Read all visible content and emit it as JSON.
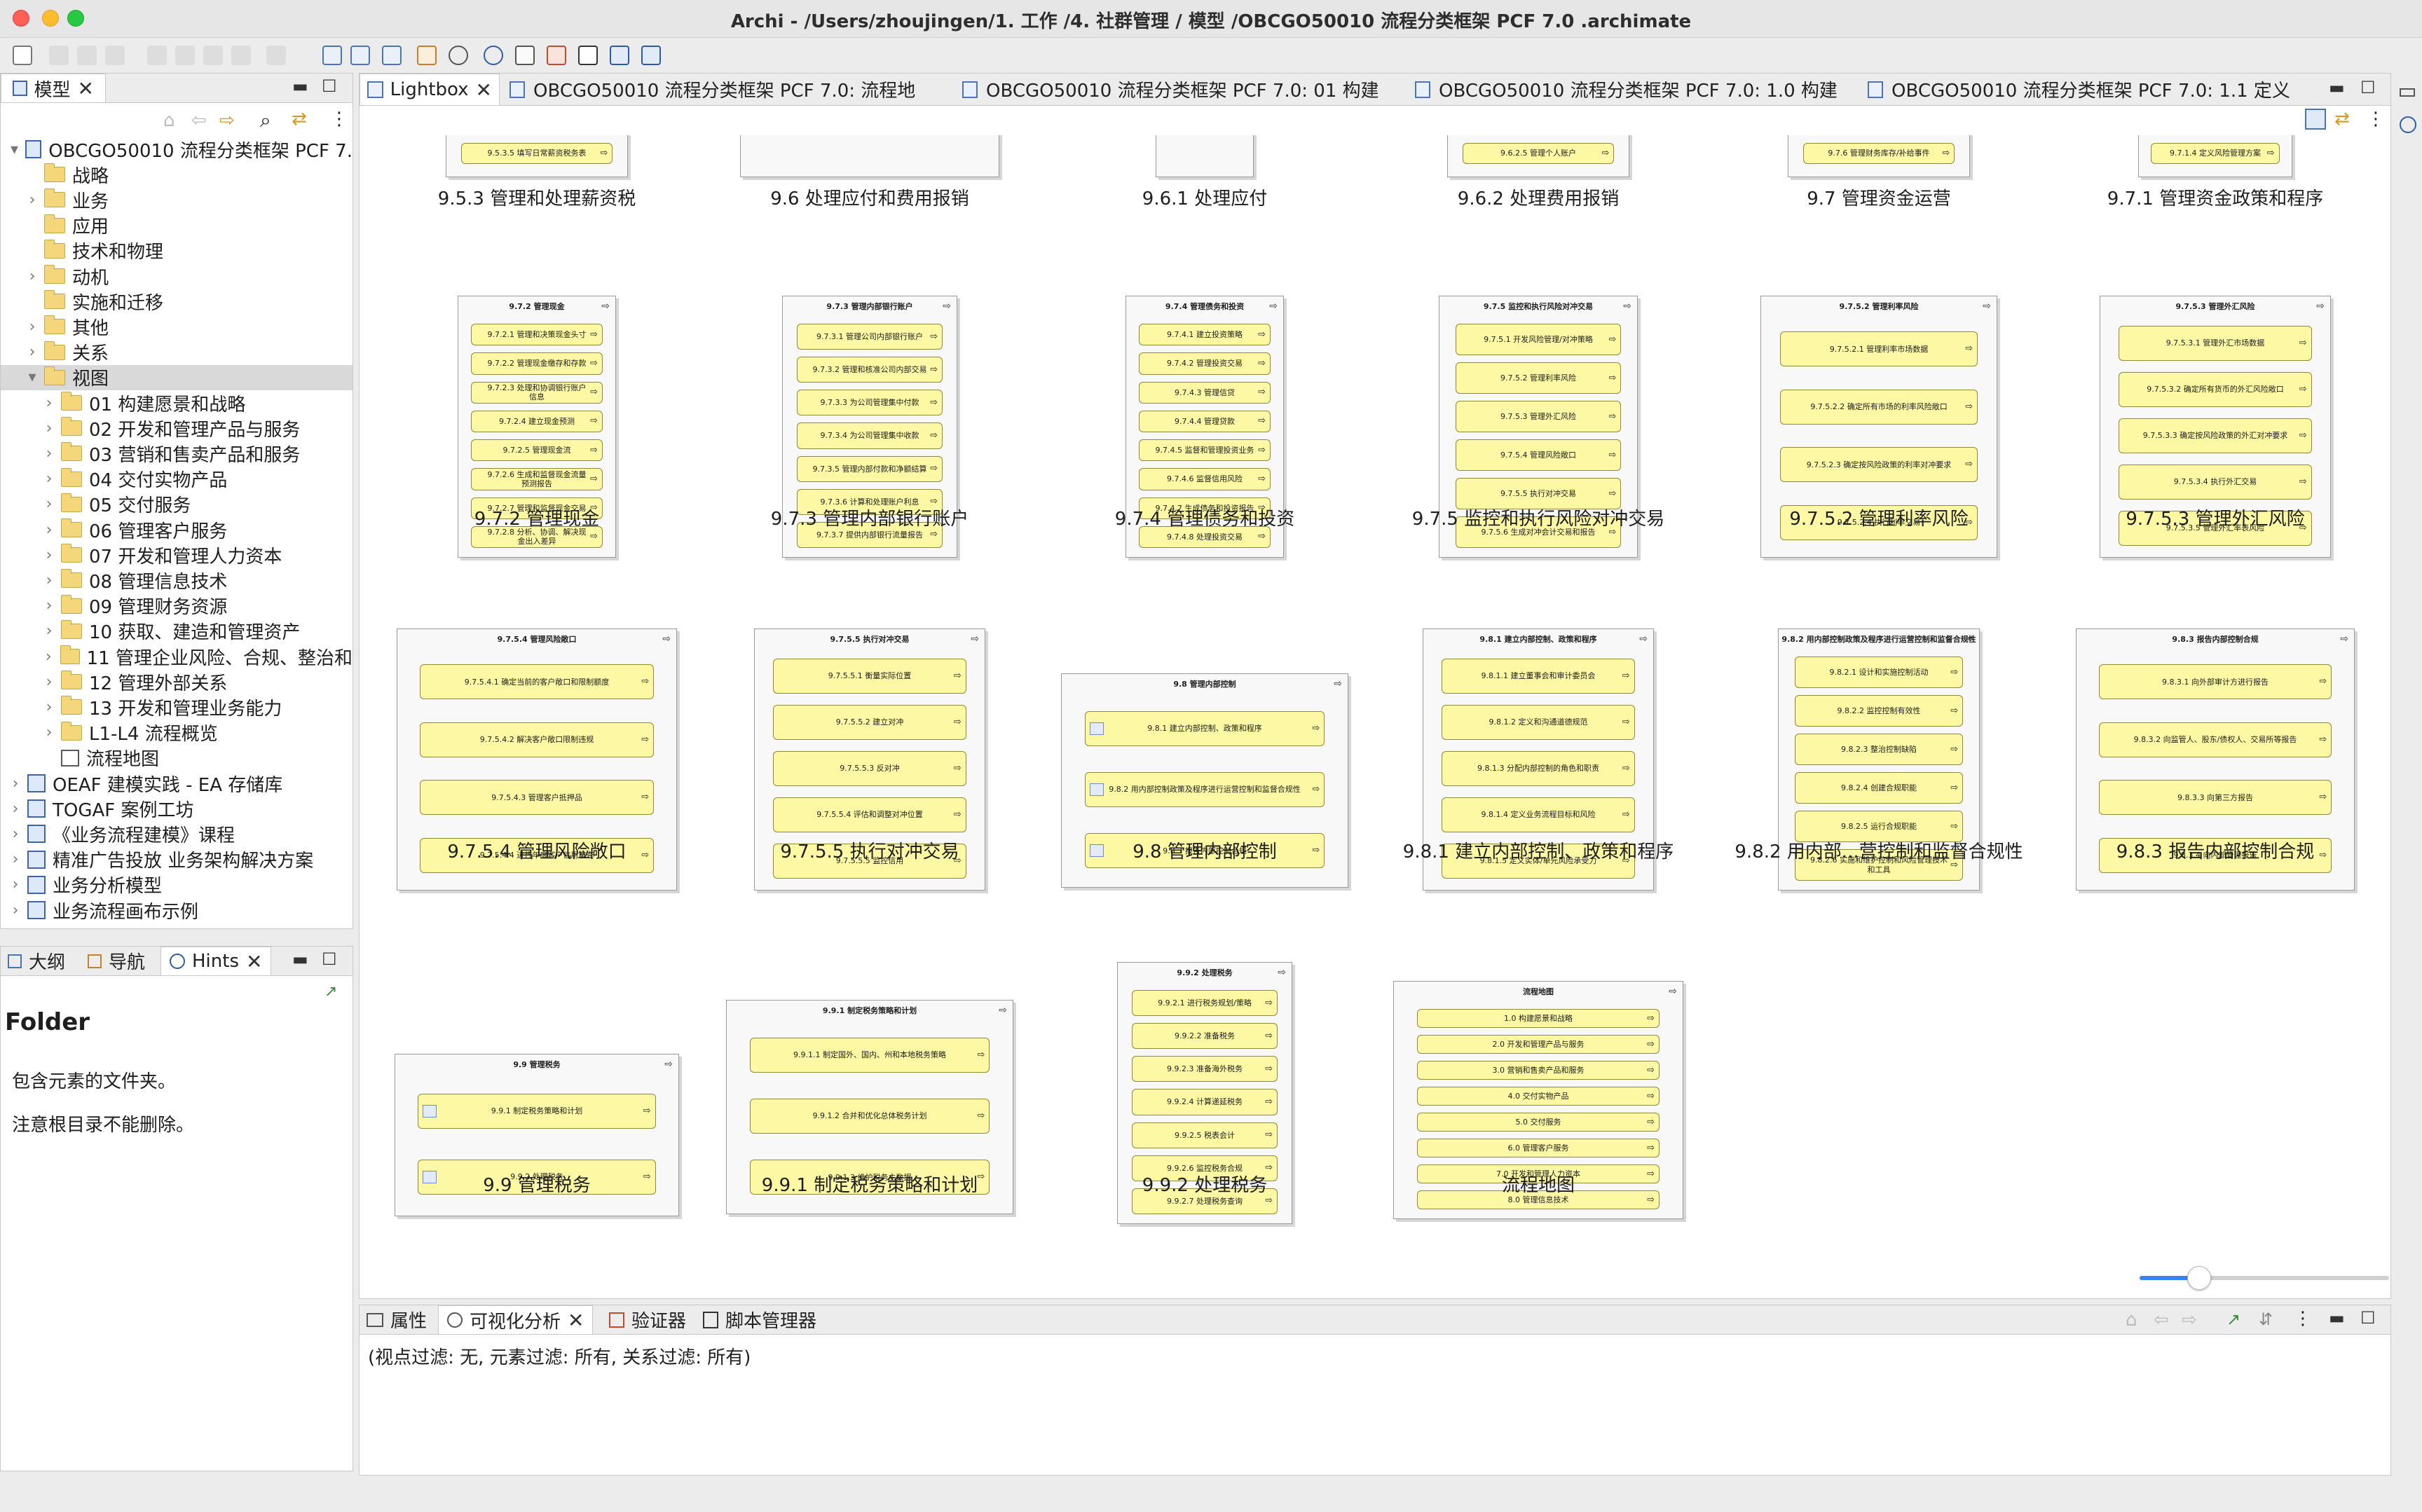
{
  "window": {
    "title": "Archi - /Users/zhoujingen/1. 工作 /4. 社群管理 / 模型 /OBCGO50010 流程分类框架 PCF 7.0 .archimate"
  },
  "left_panel": {
    "tab_label": "模型",
    "tree": [
      {
        "label": "OBCGO50010 流程分类框架 PCF 7.",
        "kind": "model",
        "twisty": "▾",
        "depth": 0
      },
      {
        "label": "战略",
        "kind": "folder",
        "twisty": "",
        "depth": 1
      },
      {
        "label": "业务",
        "kind": "folder",
        "twisty": "›",
        "depth": 1
      },
      {
        "label": "应用",
        "kind": "folder",
        "twisty": "",
        "depth": 1
      },
      {
        "label": "技术和物理",
        "kind": "folder",
        "twisty": "",
        "depth": 1
      },
      {
        "label": "动机",
        "kind": "folder",
        "twisty": "›",
        "depth": 1
      },
      {
        "label": "实施和迁移",
        "kind": "folder",
        "twisty": "",
        "depth": 1
      },
      {
        "label": "其他",
        "kind": "folder",
        "twisty": "›",
        "depth": 1
      },
      {
        "label": "关系",
        "kind": "folder",
        "twisty": "›",
        "depth": 1
      },
      {
        "label": "视图",
        "kind": "folder",
        "twisty": "▾",
        "depth": 1,
        "selected": true
      },
      {
        "label": "01 构建愿景和战略",
        "kind": "folder",
        "twisty": "›",
        "depth": 2
      },
      {
        "label": "02 开发和管理产品与服务",
        "kind": "folder",
        "twisty": "›",
        "depth": 2
      },
      {
        "label": "03 营销和售卖产品和服务",
        "kind": "folder",
        "twisty": "›",
        "depth": 2
      },
      {
        "label": "04 交付实物产品",
        "kind": "folder",
        "twisty": "›",
        "depth": 2
      },
      {
        "label": "05 交付服务",
        "kind": "folder",
        "twisty": "›",
        "depth": 2
      },
      {
        "label": "06 管理客户服务",
        "kind": "folder",
        "twisty": "›",
        "depth": 2
      },
      {
        "label": "07 开发和管理人力资本",
        "kind": "folder",
        "twisty": "›",
        "depth": 2
      },
      {
        "label": "08 管理信息技术",
        "kind": "folder",
        "twisty": "›",
        "depth": 2
      },
      {
        "label": "09 管理财务资源",
        "kind": "folder",
        "twisty": "›",
        "depth": 2
      },
      {
        "label": "10 获取、建造和管理资产",
        "kind": "folder",
        "twisty": "›",
        "depth": 2
      },
      {
        "label": "11 管理企业风险、合规、整治和",
        "kind": "folder",
        "twisty": "›",
        "depth": 2
      },
      {
        "label": "12 管理外部关系",
        "kind": "folder",
        "twisty": "›",
        "depth": 2
      },
      {
        "label": "13 开发和管理业务能力",
        "kind": "folder",
        "twisty": "›",
        "depth": 2
      },
      {
        "label": "L1-L4 流程概览",
        "kind": "folder",
        "twisty": "›",
        "depth": 2
      },
      {
        "label": "流程地图",
        "kind": "map",
        "twisty": "",
        "depth": 2
      },
      {
        "label": "OEAF 建模实践 - EA 存储库",
        "kind": "model",
        "twisty": "›",
        "depth": 0
      },
      {
        "label": "TOGAF 案例工坊",
        "kind": "model",
        "twisty": "›",
        "depth": 0
      },
      {
        "label": "《业务流程建模》课程",
        "kind": "model",
        "twisty": "›",
        "depth": 0
      },
      {
        "label": "精准广告投放 业务架构解决方案",
        "kind": "model",
        "twisty": "›",
        "depth": 0
      },
      {
        "label": "业务分析模型",
        "kind": "model",
        "twisty": "›",
        "depth": 0
      },
      {
        "label": "业务流程画布示例",
        "kind": "model",
        "twisty": "›",
        "depth": 0
      }
    ]
  },
  "hints_panel": {
    "tabs": [
      "大纲",
      "导航",
      "Hints"
    ],
    "heading": "Folder",
    "line1": "包含元素的文件夹。",
    "line2": "注意根目录不能删除。"
  },
  "editor": {
    "tabs": [
      "Lightbox",
      "OBCGO50010 流程分类框架 PCF 7.0: 流程地",
      "OBCGO50010 流程分类框架 PCF 7.0: 01 构建",
      "OBCGO50010 流程分类框架 PCF 7.0: 1.0 构建",
      "OBCGO50010 流程分类框架 PCF 7.0: 1.1 定义"
    ],
    "zoom_fraction": 0.24
  },
  "lightbox": {
    "row0": [
      "9.5.3 管理和处理薪资税",
      "9.6 处理应付和费用报销",
      "9.6.1 处理应付",
      "9.6.2 处理费用报销",
      "9.7 管理资金运营",
      "9.7.1 管理资金政策和程序"
    ],
    "row0_boxes": [
      "9.5.3.5 填写日常薪资税务表",
      "",
      "",
      "9.6.2.5 管理个人账户",
      "9.7.6 管理财务库存/补给事件",
      "9.7.1.4 定义风险管理方案"
    ],
    "cards": [
      {
        "label": "9.7.2 管理现金",
        "title": "9.7.2 管理现金",
        "boxes": [
          "9.7.2.1 管理和决策现金头寸",
          "9.7.2.2 管理现金缴存和存款",
          "9.7.2.3 处理和协调银行账户信息",
          "9.7.2.4 建立现金预测",
          "9.7.2.5 管理现金流",
          "9.7.2.6 生成和监督现金流量预测报告",
          "9.7.2.7 管理和监督现金交易",
          "9.7.2.8 分析、协调、解决现金出入差异"
        ]
      },
      {
        "label": "9.7.3 管理内部银行账户",
        "title": "9.7.3 管理内部银行账户",
        "boxes": [
          "9.7.3.1 管理公司内部银行账户",
          "9.7.3.2 管理和核准公司内部交易",
          "9.7.3.3 为公司管理集中付款",
          "9.7.3.4 为公司管理集中收款",
          "9.7.3.5 管理内部付款和净额结算",
          "9.7.3.6 计算和处理账户利息",
          "9.7.3.7 提供内部银行流量报告"
        ]
      },
      {
        "label": "9.7.4 管理债务和投资",
        "title": "9.7.4 管理债务和投资",
        "boxes": [
          "9.7.4.1 建立投资策略",
          "9.7.4.2 管理投资交易",
          "9.7.4.3 管理信贷",
          "9.7.4.4 管理贷款",
          "9.7.4.5 监督和管理投资业务",
          "9.7.4.6 监督信用风险",
          "9.7.4.7 生成债务和投资报告",
          "9.7.4.8 处理投资交易"
        ]
      },
      {
        "label": "9.7.5 监控和执行风险对冲交易",
        "title": "9.7.5 监控和执行风险对冲交易",
        "boxes": [
          "9.7.5.1 开发风险管理/对冲策略",
          "9.7.5.2 管理利率风险",
          "9.7.5.3 管理外汇风险",
          "9.7.5.4 管理风险敞口",
          "9.7.5.5 执行对冲交易",
          "9.7.5.6 生成对冲会计交易和报告"
        ]
      },
      {
        "label": "9.7.5.2 管理利率风险",
        "title": "9.7.5.2 管理利率风险",
        "boxes": [
          "9.7.5.2.1 管理利率市场数据",
          "9.7.5.2.2 确定所有市场的利率风险敞口",
          "9.7.5.2.3 确定按风险政策的利率对冲要求",
          "9.7.5.2.4 执行利率交易"
        ]
      },
      {
        "label": "9.7.5.3 管理外汇风险",
        "title": "9.7.5.3 管理外汇风险",
        "boxes": [
          "9.7.5.3.1 管理外汇市场数据",
          "9.7.5.3.2 确定所有货币的外汇风险敞口",
          "9.7.5.3.3 确定按风险政策的外汇对冲要求",
          "9.7.5.3.4 执行外汇交易",
          "9.7.5.3.5 管理外汇率表风险"
        ]
      },
      {
        "label": "9.7.5.4 管理风险敞口",
        "title": "9.7.5.4 管理风险敞口",
        "boxes": [
          "9.7.5.4.1 确定当前的客户敞口和限制额度",
          "9.7.5.4.2 解决客户敞口限制违规",
          "9.7.5.4.3 管理客户抵押品",
          "9.7.5.4.4 进行年度客户信用审查"
        ]
      },
      {
        "label": "9.7.5.5 执行对冲交易",
        "title": "9.7.5.5 执行对冲交易",
        "boxes": [
          "9.7.5.5.1 衡量实际位置",
          "9.7.5.5.2 建立对冲",
          "9.7.5.5.3 反对冲",
          "9.7.5.5.4 评估和调整对冲位置",
          "9.7.5.5.5 监控信用"
        ]
      },
      {
        "label": "9.8 管理内部控制",
        "title": "9.8 管理内部控制",
        "boxes": [
          "9.8.1 建立内部控制、政策和程序",
          "9.8.2 用内部控制政策及程序进行运营控制和监督合规性",
          "9.8.3 报告内部控制合规"
        ]
      },
      {
        "label": "9.8.1 建立内部控制、政策和程序",
        "title": "9.8.1 建立内部控制、政策和程序",
        "boxes": [
          "9.8.1.1 建立董事会和审计委员会",
          "9.8.1.2 定义和沟通道德规范",
          "9.8.1.3 分配内部控制的角色和职责",
          "9.8.1.4 定义业务流程目标和风险",
          "9.8.1.5 定义实体/单元风险承受力"
        ]
      },
      {
        "label": "9.8.2 用内部...营控制和监督合规性",
        "title": "9.8.2 用内部控制政策及程序进行运营控制和监督合规性",
        "boxes": [
          "9.8.2.1 设计和实施控制活动",
          "9.8.2.2 监控控制有效性",
          "9.8.2.3 整治控制缺陷",
          "9.8.2.4 创建合规职能",
          "9.8.2.5 运行合规职能",
          "9.8.2.6 实施和维护控制和风险管理技术和工具"
        ]
      },
      {
        "label": "9.8.3 报告内部控制合规",
        "title": "9.8.3 报告内部控制合规",
        "boxes": [
          "9.8.3.1 向外部审计方进行报告",
          "9.8.3.2 向监管人、股东/债权人、交易所等报告",
          "9.8.3.3 向第三方报告",
          "9.8.3.4 向内部管理报告"
        ]
      },
      {
        "label": "9.9 管理税务",
        "title": "9.9 管理税务",
        "boxes": [
          "9.9.1 制定税务策略和计划",
          "9.9.2 处理税务"
        ]
      },
      {
        "label": "9.9.1 制定税务策略和计划",
        "title": "9.9.1 制定税务策略和计划",
        "boxes": [
          "9.9.1.1 制定国外、国内、州和本地税务策略",
          "9.9.1.2 合并和优化总体税务计划",
          "9.9.1.3 维护税务主数据"
        ]
      },
      {
        "label": "9.9.2 处理税务",
        "title": "9.9.2 处理税务",
        "boxes": [
          "9.9.2.1 进行税务规划/策略",
          "9.9.2.2 准备税务",
          "9.9.2.3 准备海外税务",
          "9.9.2.4 计算递延税务",
          "9.9.2.5 税表会计",
          "9.9.2.6 监控税务合规",
          "9.9.2.7 处理税务查询"
        ]
      },
      {
        "label": "流程地图",
        "title": "流程地图",
        "boxes": [
          "1.0 构建愿景和战略",
          "2.0 开发和管理产品与服务",
          "3.0 营销和售卖产品和服务",
          "4.0 交付实物产品",
          "5.0 交付服务",
          "6.0 管理客户服务",
          "7.0 开发和管理人力资本",
          "8.0 管理信息技术"
        ]
      }
    ]
  },
  "bottom_panel": {
    "tabs": [
      "属性",
      "可视化分析",
      "验证器",
      "脚本管理器"
    ],
    "filter_text": "(视点过滤: 无, 元素过滤: 所有, 关系过滤: 所有)"
  },
  "colors": {
    "box_fill": "#fdf8a4",
    "selection": "#d9d9d9",
    "slider": "#3b82f6"
  }
}
